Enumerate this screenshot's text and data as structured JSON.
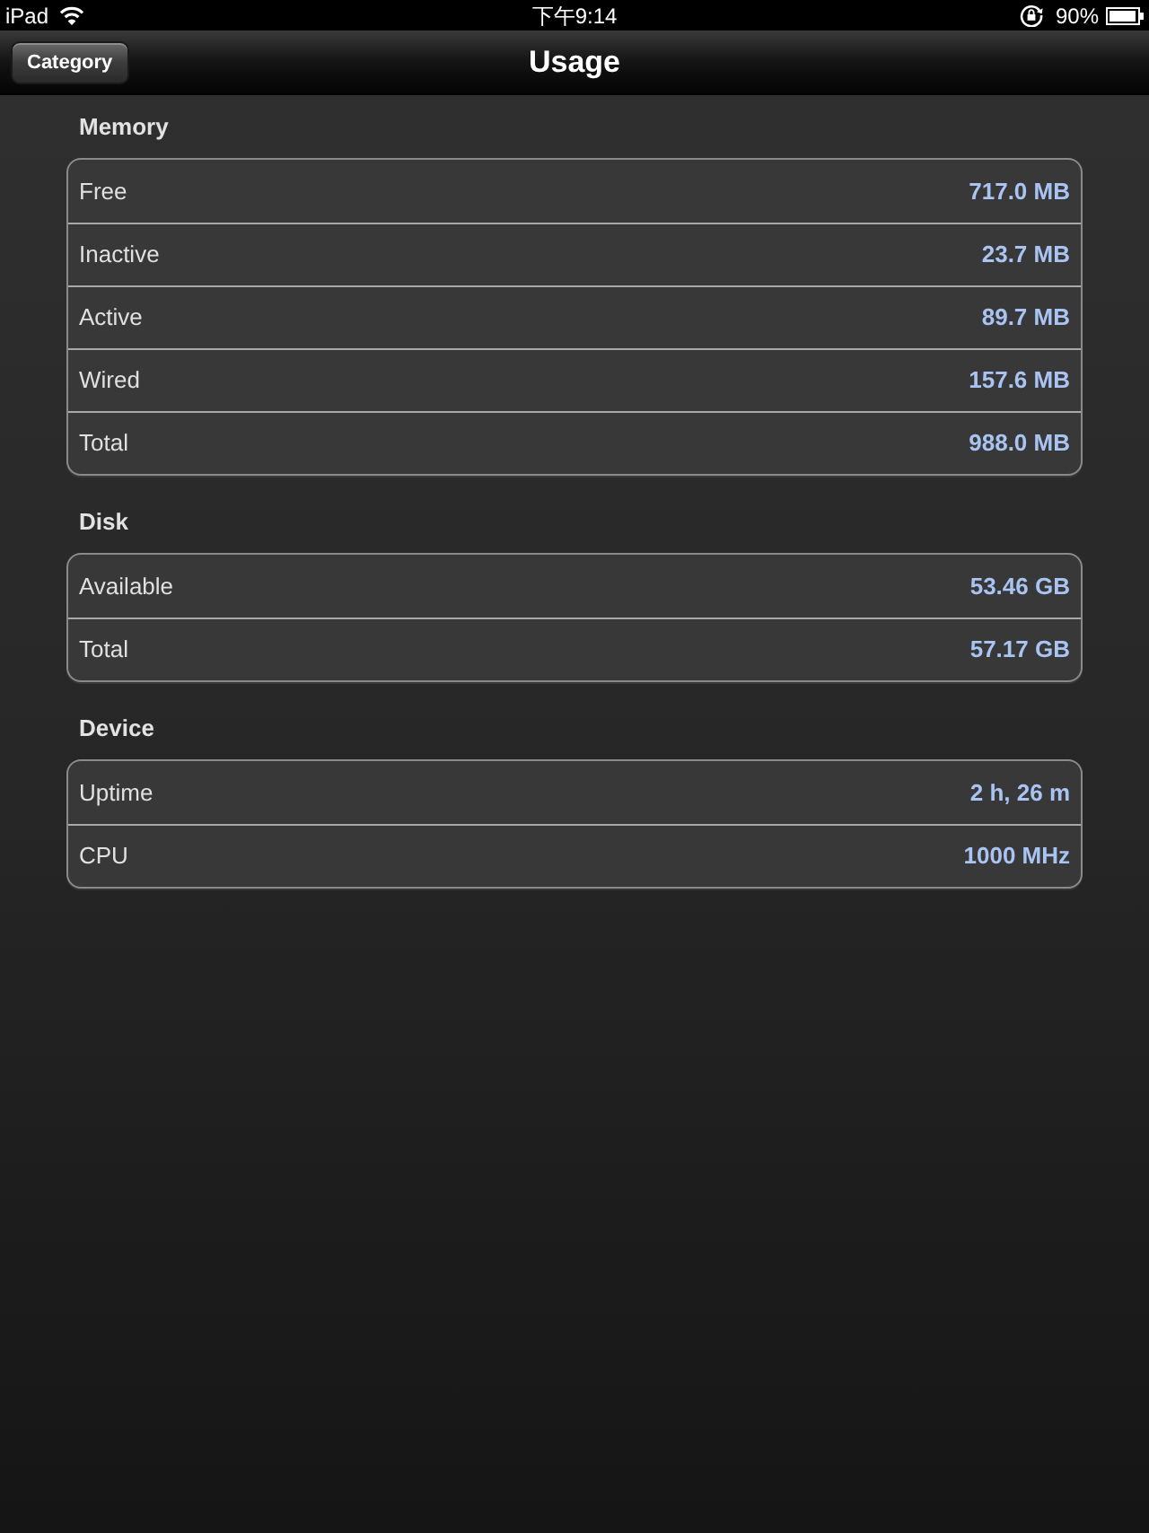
{
  "status_bar": {
    "device": "iPad",
    "time": "下午9:14",
    "battery": "90%"
  },
  "nav_bar": {
    "back_button": "Category",
    "title": "Usage"
  },
  "sections": [
    {
      "title": "Memory",
      "rows": [
        {
          "label": "Free",
          "value": "717.0 MB"
        },
        {
          "label": "Inactive",
          "value": "23.7 MB"
        },
        {
          "label": "Active",
          "value": "89.7 MB"
        },
        {
          "label": "Wired",
          "value": "157.6 MB"
        },
        {
          "label": "Total",
          "value": "988.0 MB"
        }
      ]
    },
    {
      "title": "Disk",
      "rows": [
        {
          "label": "Available",
          "value": "53.46 GB"
        },
        {
          "label": "Total",
          "value": "57.17 GB"
        }
      ]
    },
    {
      "title": "Device",
      "rows": [
        {
          "label": "Uptime",
          "value": "2 h, 26 m"
        },
        {
          "label": "CPU",
          "value": "1000 MHz"
        }
      ]
    }
  ]
}
